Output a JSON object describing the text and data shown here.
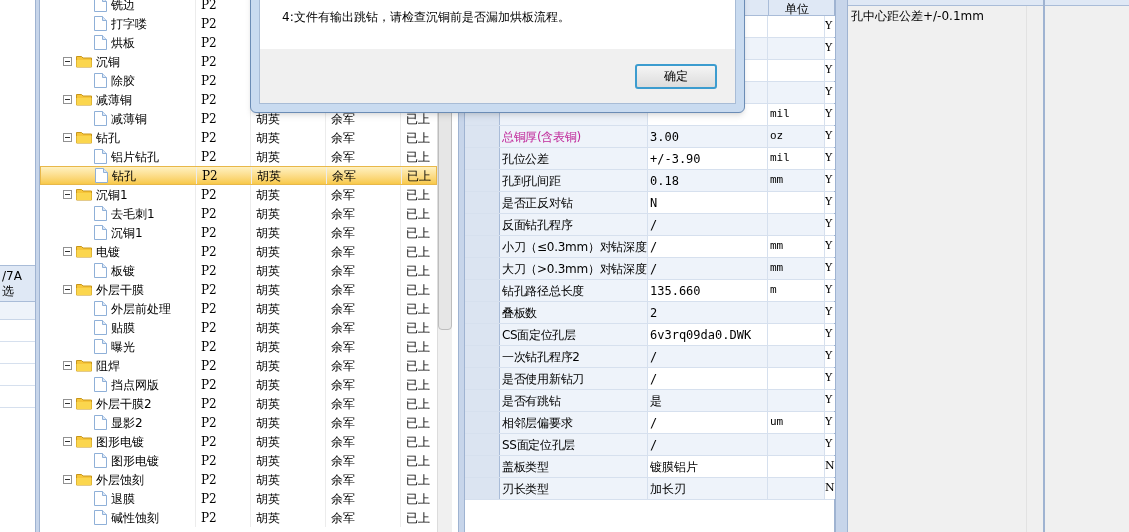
{
  "left_panel": {
    "header_lines": [
      "/7A",
      "选"
    ]
  },
  "tree": {
    "items": [
      {
        "children": [
          {
            "label": "铣边",
            "kind": "file",
            "selected": false,
            "cells": [
              "P2"
            ]
          },
          {
            "label": "打字喽",
            "kind": "file",
            "selected": false,
            "cells": [
              "P2"
            ]
          },
          {
            "label": "烘板",
            "kind": "file",
            "selected": false,
            "cells": [
              "P2"
            ]
          }
        ]
      },
      {
        "label": "沉铜",
        "kind": "folder",
        "expanded": true,
        "selected": false,
        "cells": [
          "P2"
        ],
        "children": [
          {
            "label": "除胶",
            "kind": "file",
            "selected": false,
            "cells": [
              "P2"
            ]
          }
        ]
      },
      {
        "label": "减薄铜",
        "kind": "folder",
        "expanded": true,
        "selected": false,
        "cells": [
          "P2"
        ],
        "children": [
          {
            "label": "减薄铜",
            "kind": "file",
            "selected": false,
            "cells": [
              "P2",
              "胡英",
              "余军",
              "已上"
            ]
          }
        ]
      },
      {
        "label": "钻孔",
        "kind": "folder",
        "expanded": true,
        "selected": false,
        "cells": [
          "P2",
          "胡英",
          "余军",
          "已上"
        ],
        "children": [
          {
            "label": "铝片钻孔",
            "kind": "file",
            "selected": false,
            "cells": [
              "P2",
              "胡英",
              "余军",
              "已上"
            ]
          },
          {
            "label": "钻孔",
            "kind": "file",
            "selected": true,
            "cells": [
              "P2",
              "胡英",
              "余军",
              "已上"
            ]
          }
        ]
      },
      {
        "label": "沉铜1",
        "kind": "folder",
        "expanded": true,
        "selected": false,
        "cells": [
          "P2",
          "胡英",
          "余军",
          "已上"
        ],
        "children": [
          {
            "label": "去毛刺1",
            "kind": "file",
            "selected": false,
            "cells": [
              "P2",
              "胡英",
              "余军",
              "已上"
            ]
          },
          {
            "label": "沉铜1",
            "kind": "file",
            "selected": false,
            "cells": [
              "P2",
              "胡英",
              "余军",
              "已上"
            ]
          }
        ]
      },
      {
        "label": "电镀",
        "kind": "folder",
        "expanded": true,
        "selected": false,
        "cells": [
          "P2",
          "胡英",
          "余军",
          "已上"
        ],
        "children": [
          {
            "label": "板镀",
            "kind": "file",
            "selected": false,
            "cells": [
              "P2",
              "胡英",
              "余军",
              "已上"
            ]
          }
        ]
      },
      {
        "label": "外层干膜",
        "kind": "folder",
        "expanded": true,
        "selected": false,
        "cells": [
          "P2",
          "胡英",
          "余军",
          "已上"
        ],
        "children": [
          {
            "label": "外层前处理",
            "kind": "file",
            "selected": false,
            "cells": [
              "P2",
              "胡英",
              "余军",
              "已上"
            ]
          },
          {
            "label": "贴膜",
            "kind": "file",
            "selected": false,
            "cells": [
              "P2",
              "胡英",
              "余军",
              "已上"
            ]
          },
          {
            "label": "曝光",
            "kind": "file",
            "selected": false,
            "cells": [
              "P2",
              "胡英",
              "余军",
              "已上"
            ]
          }
        ]
      },
      {
        "label": "阻焊",
        "kind": "folder",
        "expanded": true,
        "selected": false,
        "cells": [
          "P2",
          "胡英",
          "余军",
          "已上"
        ],
        "children": [
          {
            "label": "挡点网版",
            "kind": "file",
            "selected": false,
            "cells": [
              "P2",
              "胡英",
              "余军",
              "已上"
            ]
          }
        ]
      },
      {
        "label": "外层干膜2",
        "kind": "folder",
        "expanded": true,
        "selected": false,
        "cells": [
          "P2",
          "胡英",
          "余军",
          "已上"
        ],
        "children": [
          {
            "label": "显影2",
            "kind": "file",
            "selected": false,
            "cells": [
              "P2",
              "胡英",
              "余军",
              "已上"
            ]
          }
        ]
      },
      {
        "label": "图形电镀",
        "kind": "folder",
        "expanded": true,
        "selected": false,
        "cells": [
          "P2",
          "胡英",
          "余军",
          "已上"
        ],
        "children": [
          {
            "label": "图形电镀",
            "kind": "file",
            "selected": false,
            "cells": [
              "P2",
              "胡英",
              "余军",
              "已上"
            ]
          }
        ]
      },
      {
        "label": "外层蚀刻",
        "kind": "folder",
        "expanded": true,
        "selected": false,
        "cells": [
          "P2",
          "胡英",
          "余军",
          "已上"
        ],
        "children": [
          {
            "label": "退膜",
            "kind": "file",
            "selected": false,
            "cells": [
              "P2",
              "胡英",
              "余军",
              "已上"
            ]
          },
          {
            "label": "碱性蚀刻",
            "kind": "file",
            "selected": false,
            "cells": [
              "P2",
              "胡英",
              "余军",
              "已上"
            ]
          }
        ]
      }
    ]
  },
  "params": {
    "header_unit": "单位",
    "rows": [
      {
        "flag": "Y"
      },
      {
        "flag": "Y"
      },
      {
        "flag": "Y"
      },
      {
        "flag": "Y"
      },
      {
        "unit": "mil",
        "flag": "Y"
      },
      {
        "name": "总铜厚(含表铜)",
        "color": "#c0289a",
        "value": "3.00",
        "unit": "oz",
        "flag": "Y"
      },
      {
        "name": "孔位公差",
        "value": "+/-3.90",
        "unit": "mil",
        "flag": "Y"
      },
      {
        "name": "孔到孔间距",
        "value": "0.18",
        "unit": "mm",
        "flag": "Y"
      },
      {
        "name": "是否正反对钻",
        "value": "N",
        "flag": "Y"
      },
      {
        "name": "反面钻孔程序",
        "value": "/",
        "flag": "Y"
      },
      {
        "name": "小刀（≤0.3mm）对钻深度",
        "value": "/",
        "unit": "mm",
        "flag": "Y"
      },
      {
        "name": "大刀（>0.3mm）对钻深度",
        "value": "/",
        "unit": "mm",
        "flag": "Y"
      },
      {
        "name": "钻孔路径总长度",
        "value": "135.660",
        "unit": "m",
        "flag": "Y"
      },
      {
        "name": "叠板数",
        "value": "2",
        "flag": "Y"
      },
      {
        "name": "CS面定位孔层",
        "value": "6v3rq09da0.DWK",
        "flag": "Y"
      },
      {
        "name": "一次钻孔程序2",
        "value": "/",
        "flag": "Y"
      },
      {
        "name": "是否使用新钻刀",
        "value": "/",
        "flag": "Y"
      },
      {
        "name": "是否有跳钻",
        "value": "是",
        "flag": "Y"
      },
      {
        "name": "相邻层偏要求",
        "value": "/",
        "unit": "um",
        "flag": "Y"
      },
      {
        "name": "SS面定位孔层",
        "value": "/",
        "flag": "Y"
      },
      {
        "name": "盖板类型",
        "value": "镀膜铝片",
        "flag": "N"
      },
      {
        "name": "刃长类型",
        "value": "加长刃",
        "flag": "N"
      }
    ]
  },
  "notes": {
    "text": "孔中心距公差+/-0.1mm"
  },
  "dialog": {
    "message": "4:文件有输出跳钻，请检查沉铜前是否漏加烘板流程。",
    "button": "确定"
  }
}
